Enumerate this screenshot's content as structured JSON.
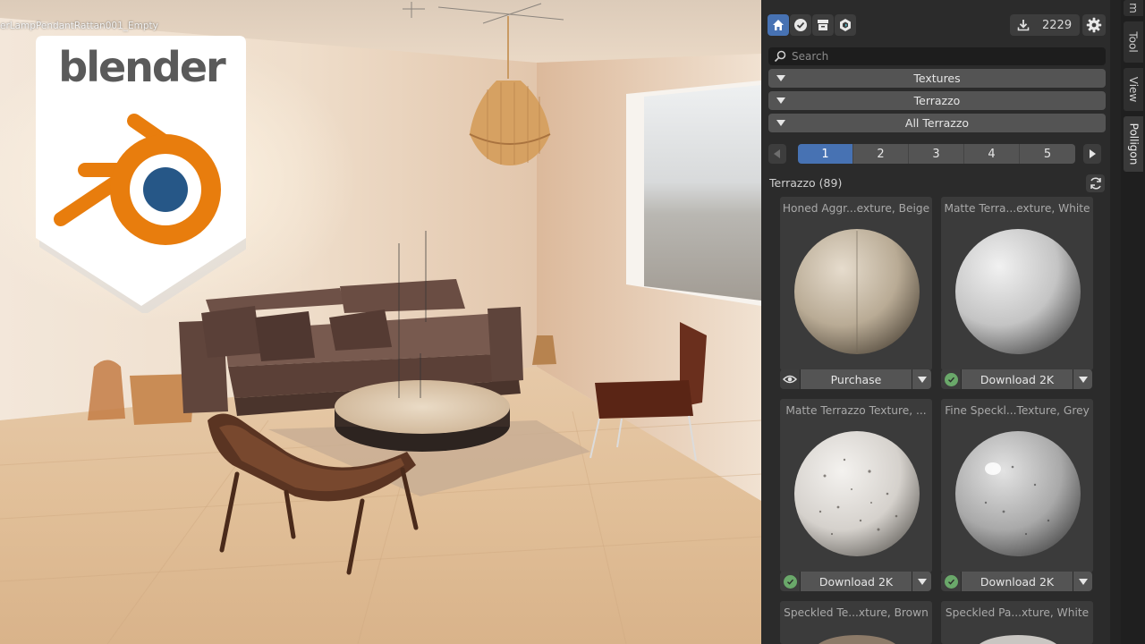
{
  "viewport": {
    "object_label": "erLampPendantRattan001_Empty",
    "logo_word": "blender"
  },
  "header": {
    "tabs": [
      {
        "icon": "home-icon",
        "active": true
      },
      {
        "icon": "check-circle-icon",
        "active": false
      },
      {
        "icon": "archive-icon",
        "active": false
      },
      {
        "icon": "polygon-logo-icon",
        "active": false
      }
    ],
    "download_count": "2229"
  },
  "search": {
    "placeholder": "Search",
    "value": ""
  },
  "filters": {
    "type": "Textures",
    "category": "Terrazzo",
    "subcategory": "All Terrazzo"
  },
  "pager": {
    "pages": [
      "1",
      "2",
      "3",
      "4",
      "5"
    ],
    "active": "1"
  },
  "results": {
    "title": "Terrazzo (89)",
    "cards": [
      {
        "title": "Honed Aggr...exture, Beige",
        "action": "Purchase",
        "status": "preview"
      },
      {
        "title": "Matte Terra...exture, White",
        "action": "Download 2K",
        "status": "owned"
      },
      {
        "title": "Matte Terrazzo Texture, ...",
        "action": "Download 2K",
        "status": "owned"
      },
      {
        "title": "Fine Speckl...Texture, Grey",
        "action": "Download 2K",
        "status": "owned"
      },
      {
        "title": "Speckled Te...xture, Brown",
        "action": "",
        "status": ""
      },
      {
        "title": "Speckled Pa...xture, White",
        "action": "",
        "status": ""
      }
    ]
  },
  "side_tabs": [
    "m",
    "Tool",
    "View",
    "Polligon"
  ],
  "colors": {
    "accent": "#4772b3",
    "panel_bg": "#2b2b2b",
    "owned_check": "#6aa86a",
    "blender_orange": "#e87d0d",
    "blender_blue": "#265787"
  }
}
